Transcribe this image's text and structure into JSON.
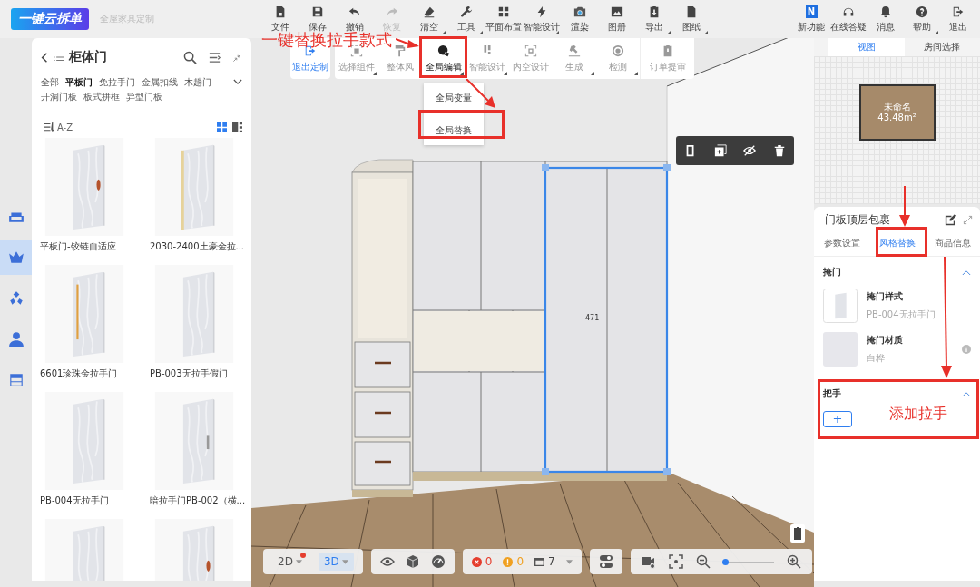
{
  "logo": {
    "title": "一键云拆单",
    "subtitle": "全屋家具定制"
  },
  "toolbar": [
    {
      "label": "文件",
      "disabled": false,
      "has_menu": false
    },
    {
      "label": "保存",
      "disabled": false,
      "has_menu": false
    },
    {
      "label": "撤销",
      "disabled": false,
      "has_menu": false
    },
    {
      "label": "恢复",
      "disabled": true,
      "has_menu": false
    },
    {
      "label": "清空",
      "disabled": false,
      "has_menu": true
    },
    {
      "label": "工具",
      "disabled": false,
      "has_menu": true
    },
    {
      "label": "平面布置",
      "disabled": false,
      "has_menu": false
    },
    {
      "label": "智能设计",
      "disabled": false,
      "has_menu": true
    },
    {
      "label": "渲染",
      "disabled": false,
      "has_menu": false
    },
    {
      "label": "图册",
      "disabled": false,
      "has_menu": false
    },
    {
      "label": "导出",
      "disabled": false,
      "has_menu": true
    },
    {
      "label": "图纸",
      "disabled": false,
      "has_menu": true
    }
  ],
  "top_right": [
    {
      "label": "新功能",
      "badge": "N",
      "has_menu": false
    },
    {
      "label": "在线答疑",
      "has_menu": false
    },
    {
      "label": "消息",
      "has_menu": false
    },
    {
      "label": "帮助",
      "has_menu": true
    },
    {
      "label": "退出",
      "has_menu": false
    }
  ],
  "left_rail": [
    {
      "selected": false
    },
    {
      "selected": true
    },
    {
      "selected": false
    },
    {
      "selected": false
    },
    {
      "selected": false
    }
  ],
  "catalog": {
    "title": "柜体门",
    "categories": [
      {
        "label": "全部",
        "selected": false
      },
      {
        "label": "平板门",
        "selected": true
      },
      {
        "label": "免拉手门",
        "selected": false
      },
      {
        "label": "金属扣线",
        "selected": false
      },
      {
        "label": "木趟门",
        "selected": false
      },
      {
        "label": "开洞门板",
        "selected": false
      },
      {
        "label": "板式拼框",
        "selected": false
      },
      {
        "label": "异型门板",
        "selected": false
      }
    ],
    "sort": "A-Z",
    "views": [
      {
        "selected": true
      },
      {
        "selected": false
      }
    ],
    "products": [
      {
        "name": "平板门-铰链自适应",
        "kind": "knob"
      },
      {
        "name": "2030-2400土豪金拉...",
        "kind": "edge"
      },
      {
        "name": "6601珍珠金拉手门",
        "kind": "bar"
      },
      {
        "name": "PB-003无拉手假门",
        "kind": "none"
      },
      {
        "name": "PB-004无拉手门",
        "kind": "none"
      },
      {
        "name": "暗拉手门PB-002（横...",
        "kind": "slot"
      },
      {
        "kind": "none"
      },
      {
        "kind": "knob"
      }
    ]
  },
  "edit_toolbar": [
    {
      "label": "退出定制",
      "selected": false,
      "has_menu": false
    },
    {
      "label": "选择组件",
      "selected": false,
      "has_menu": true
    },
    {
      "label": "整体风",
      "selected": false,
      "has_menu": false
    },
    {
      "label": "全局编辑",
      "selected": true,
      "has_menu": true
    },
    {
      "label": "智能设计",
      "selected": false,
      "has_menu": true
    },
    {
      "label": "内空设计",
      "selected": false,
      "has_menu": false
    },
    {
      "label": "生成",
      "selected": false,
      "has_menu": true
    },
    {
      "label": "检测",
      "selected": false,
      "has_menu": true
    },
    {
      "label": "订单提审",
      "selected": false,
      "has_menu": false
    }
  ],
  "edit_menu": [
    "全局变量",
    "全局替换"
  ],
  "dimension": "471",
  "bottom_bar": {
    "view_modes": [
      {
        "label": "2D",
        "selected": false,
        "notification": true
      },
      {
        "label": "3D",
        "selected": true,
        "notification": false
      }
    ],
    "errors": "0",
    "warnings": "0",
    "layers": "7",
    "zoom": {
      "level": 0.05
    }
  },
  "minimap": {
    "tabs": [
      {
        "label": "视图",
        "selected": true
      },
      {
        "label": "房间选择",
        "selected": false
      }
    ],
    "room_name": "未命名",
    "room_area": "43.48m²"
  },
  "properties": {
    "title": "门板顶层包裹",
    "tabs": [
      {
        "label": "参数设置",
        "selected": false
      },
      {
        "label": "风格替换",
        "selected": true
      },
      {
        "label": "商品信息",
        "selected": false
      }
    ],
    "sections": [
      {
        "title": "掩门",
        "expanded": true,
        "items": [
          {
            "title": "掩门样式",
            "value": "PB-004无拉手门",
            "kind": "style"
          },
          {
            "title": "掩门材质",
            "value": "白桦",
            "kind": "material"
          }
        ]
      },
      {
        "title": "把手",
        "expanded": true,
        "add_button": "+"
      }
    ]
  },
  "annotations": [
    {
      "text": "一键替换拉手款式"
    },
    {
      "text": "添加拉手"
    }
  ]
}
